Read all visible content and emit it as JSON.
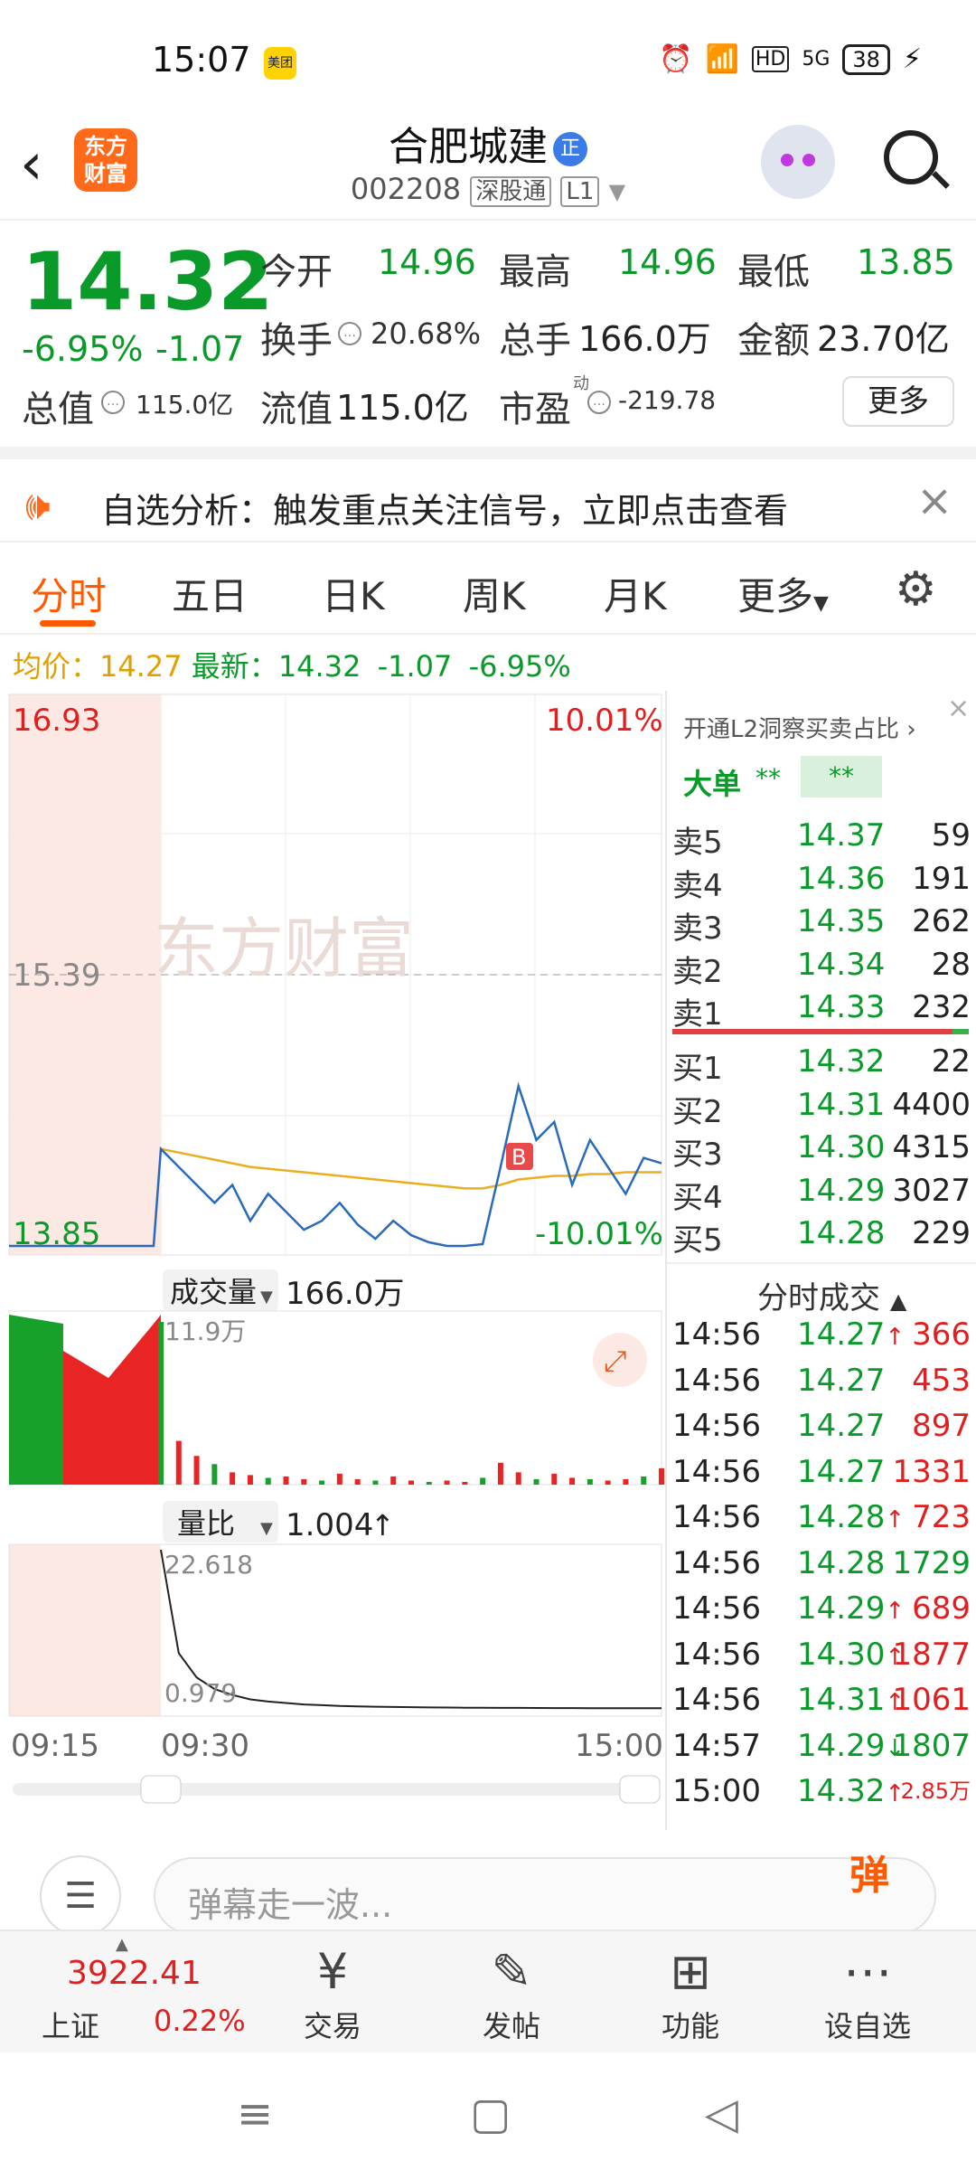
{
  "status_bar": {
    "time": "15:07",
    "app_badge": "美团",
    "icons": [
      "alarm-icon",
      "wifi-icon",
      "hd-icon",
      "5g-icon"
    ],
    "battery": "38"
  },
  "header": {
    "logo_text": "东方\n财富",
    "stock_name": "合肥城建",
    "badge": "正",
    "code": "002208",
    "tag1": "深股通",
    "tag2": "L1"
  },
  "quote": {
    "price": "14.32",
    "change_pct": "-6.95%",
    "change": "-1.07",
    "open_label": "今开",
    "open": "14.96",
    "high_label": "最高",
    "high": "14.96",
    "low_label": "最低",
    "low": "13.85",
    "turnover_label": "换手",
    "turnover": "20.68%",
    "volume_label": "总手",
    "volume": "166.0万",
    "amount_label": "金额",
    "amount": "23.70亿",
    "total_value_label": "总值",
    "total_value": "115.0亿",
    "float_value_label": "流值",
    "float_value": "115.0亿",
    "pe_label": "市盈",
    "pe_sup": "动",
    "pe": "-219.78",
    "more_label": "更多"
  },
  "notice": {
    "text": "自选分析：触发重点关注信号，立即点击查看"
  },
  "tabs": [
    "分时",
    "五日",
    "日K",
    "周K",
    "月K",
    "更多"
  ],
  "avg_line": {
    "avg_label": "均价：",
    "avg": "14.27",
    "latest_label": "最新：",
    "latest": "14.32",
    "chg": "-1.07",
    "pct": "-6.95%"
  },
  "chart_data": {
    "type": "line",
    "title": "",
    "y_top_label": "16.93",
    "y_mid_label": "15.39",
    "y_bottom_label": "13.85",
    "pct_top_label": "10.01%",
    "pct_bottom_label": "-10.01%",
    "ylim": [
      13.85,
      16.93
    ],
    "x_labels": [
      "09:15",
      "09:30",
      "15:00"
    ],
    "marker_label": "B",
    "price_series": {
      "name": "",
      "values": [
        14.4,
        14.3,
        14.2,
        14.1,
        14.2,
        14.0,
        14.15,
        14.05,
        13.95,
        14.0,
        14.1,
        13.98,
        13.9,
        14.0,
        13.92,
        13.88,
        13.86,
        13.86,
        13.87,
        14.3,
        14.75,
        14.45,
        14.55,
        14.2,
        14.45,
        14.3,
        14.15,
        14.35,
        14.32
      ]
    },
    "avg_series": {
      "name": "",
      "values": [
        14.4,
        14.38,
        14.36,
        14.34,
        14.32,
        14.3,
        14.29,
        14.28,
        14.27,
        14.26,
        14.25,
        14.24,
        14.23,
        14.22,
        14.21,
        14.2,
        14.19,
        14.18,
        14.18,
        14.2,
        14.23,
        14.24,
        14.25,
        14.25,
        14.26,
        14.26,
        14.27,
        14.27,
        14.27
      ]
    },
    "volume_label": "成交量",
    "volume_total": "166.0万",
    "volume_max_label": "11.9万",
    "volume_values": [
      11.9,
      3.2,
      2.1,
      1.5,
      0.9,
      0.7,
      0.5,
      0.6,
      0.4,
      0.3,
      0.8,
      0.4,
      0.3,
      0.6,
      0.3,
      0.2,
      0.3,
      0.2,
      0.5,
      1.6,
      0.9,
      0.4,
      0.8,
      0.5,
      0.4,
      0.3,
      0.4,
      0.6,
      1.2
    ],
    "ratio_label": "量比",
    "ratio_value": "1.004",
    "ratio_max_label": "22.618",
    "ratio_min_label": "0.979",
    "ratio_values": [
      22.618,
      8.5,
      5.2,
      3.6,
      2.8,
      2.2,
      1.9,
      1.7,
      1.5,
      1.4,
      1.3,
      1.25,
      1.2,
      1.16,
      1.13,
      1.1,
      1.08,
      1.06,
      1.05,
      1.04,
      1.03,
      1.02,
      1.01,
      1.01,
      1.0,
      1.0,
      1.0,
      1.0,
      1.004
    ]
  },
  "book": {
    "l2_text": "开通L2洞察买卖占比",
    "dadan_label": "大单",
    "dadan_v1": "**",
    "dadan_v2": "**",
    "asks": [
      {
        "k": "卖5",
        "p": "14.37",
        "v": "59"
      },
      {
        "k": "卖4",
        "p": "14.36",
        "v": "191"
      },
      {
        "k": "卖3",
        "p": "14.35",
        "v": "262"
      },
      {
        "k": "卖2",
        "p": "14.34",
        "v": "28"
      },
      {
        "k": "卖1",
        "p": "14.33",
        "v": "232"
      }
    ],
    "bids": [
      {
        "k": "买1",
        "p": "14.32",
        "v": "22"
      },
      {
        "k": "买2",
        "p": "14.31",
        "v": "4400"
      },
      {
        "k": "买3",
        "p": "14.30",
        "v": "4315"
      },
      {
        "k": "买4",
        "p": "14.29",
        "v": "3027"
      },
      {
        "k": "买5",
        "p": "14.28",
        "v": "229"
      }
    ],
    "ticks_title": "分时成交",
    "ticks": [
      {
        "t": "14:56",
        "p": "14.27",
        "a": "↑",
        "v": "366"
      },
      {
        "t": "14:56",
        "p": "14.27",
        "a": "",
        "v": "453"
      },
      {
        "t": "14:56",
        "p": "14.27",
        "a": "",
        "v": "897"
      },
      {
        "t": "14:56",
        "p": "14.27",
        "a": "",
        "v": "1331"
      },
      {
        "t": "14:56",
        "p": "14.28",
        "a": "↑",
        "v": "723"
      },
      {
        "t": "14:56",
        "p": "14.28",
        "a": "",
        "v": "1729"
      },
      {
        "t": "14:56",
        "p": "14.29",
        "a": "↑",
        "v": "689"
      },
      {
        "t": "14:56",
        "p": "14.30",
        "a": "↑",
        "v": "1877"
      },
      {
        "t": "14:56",
        "p": "14.31",
        "a": "↑",
        "v": "1061"
      },
      {
        "t": "14:57",
        "p": "14.29",
        "a": "↓",
        "v": "1807"
      },
      {
        "t": "15:00",
        "p": "14.32",
        "a": "↑",
        "v": "2.85万"
      }
    ]
  },
  "comment": {
    "placeholder": "弹幕走一波...",
    "dan": "弹"
  },
  "bottom_nav": {
    "index_value": "3922.41",
    "index_name": "上证",
    "index_pct": "0.22%",
    "items": [
      "交易",
      "发帖",
      "功能",
      "设自选"
    ]
  },
  "colors": {
    "up": "#e02020",
    "down": "#0a9a2a",
    "accent": "#ff5a00"
  }
}
